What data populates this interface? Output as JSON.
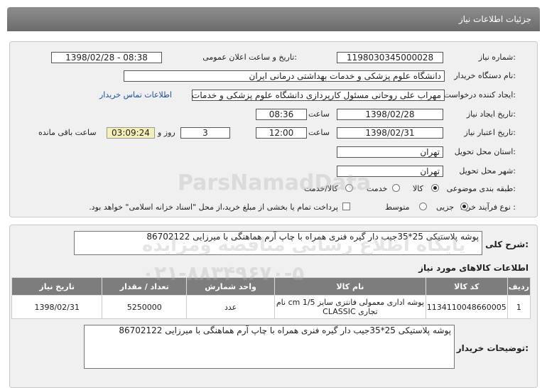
{
  "title": "جزئیات اطلاعات نیاز",
  "watermark": {
    "brand": "ParsNamadData",
    "line1": "پایگاه اطلاع رسانی مناقصه ومزایده",
    "phone": "۰۲۱-۸۸۳۴۹۶۷۰-۵"
  },
  "form": {
    "need_number_label": "شماره نیاز:",
    "need_number": "1198030345000028",
    "announce_label": "تاریخ و ساعت اعلان عمومی:",
    "announce_value": "1398/02/28 - 08:38",
    "buyer_label": "نام دستگاه خریدار:",
    "buyer": "دانشگاه علوم پزشکی و خدمات بهداشتی درمانی ایران",
    "creator_label": "ایجاد کننده درخواست:",
    "creator": "مهراب علی روحانی مسئول کارپردازی دانشگاه علوم پزشکی و خدمات بهداشتی",
    "contact_link": "اطلاعات تماس خریدار",
    "created_date_label": "تاریخ ایجاد نیاز:",
    "created_date": "1398/02/28",
    "time_label": "ساعت",
    "created_time": "08:36",
    "validity_label": "تاریخ اعتبار نیاز:",
    "validity_date": "1398/02/31",
    "validity_time": "12:00",
    "days_value": "3",
    "days_label": "روز و",
    "remaining_time": "03:09:24",
    "remaining_label": "ساعت باقی مانده",
    "province_label": "استان محل تحویل:",
    "province": "تهران",
    "city_label": "شهر محل تحویل:",
    "city": "تهران",
    "category_label": "طبقه بندی موضوعی:",
    "category_options": [
      "کالا",
      "خدمت",
      "کالا/خدمت"
    ],
    "purchase_label": "نوع فرآیند خرید :",
    "purchase_options": [
      "جزیی",
      "متوسط"
    ],
    "payment_note": "پرداخت تمام یا بخشی از مبلغ خرید،از محل \"اسناد خزانه اسلامی\" خواهد بود."
  },
  "summary": {
    "label": "شرح کلی نیاز:",
    "text": "پوشه پلاستیکی 25*35جیب دار گیره فنری همراه با چاپ آرم  هماهنگی با  میرزایی 86702122"
  },
  "items": {
    "heading": "اطلاعات کالاهای مورد نیاز",
    "columns": [
      "ردیف",
      "کد کالا",
      "نام کالا",
      "واحد شمارش",
      "تعداد / مقدار",
      "تاریخ نیاز"
    ],
    "rows": [
      {
        "row": "1",
        "code": "1134110048660005",
        "name": "پوشه اداری معمولی فانتزی سایز 1/5 cm نام تجاری CLASSIC",
        "unit": "عدد",
        "qty": "5250000",
        "date": "1398/02/31"
      }
    ]
  },
  "buyer_notes": {
    "label": "توضیحات خریدار:",
    "text": "پوشه پلاستیکی 25*35جیب دار گیره فنری همراه با چاپ آرم  هماهنگی با  میرزایی 86702122"
  }
}
